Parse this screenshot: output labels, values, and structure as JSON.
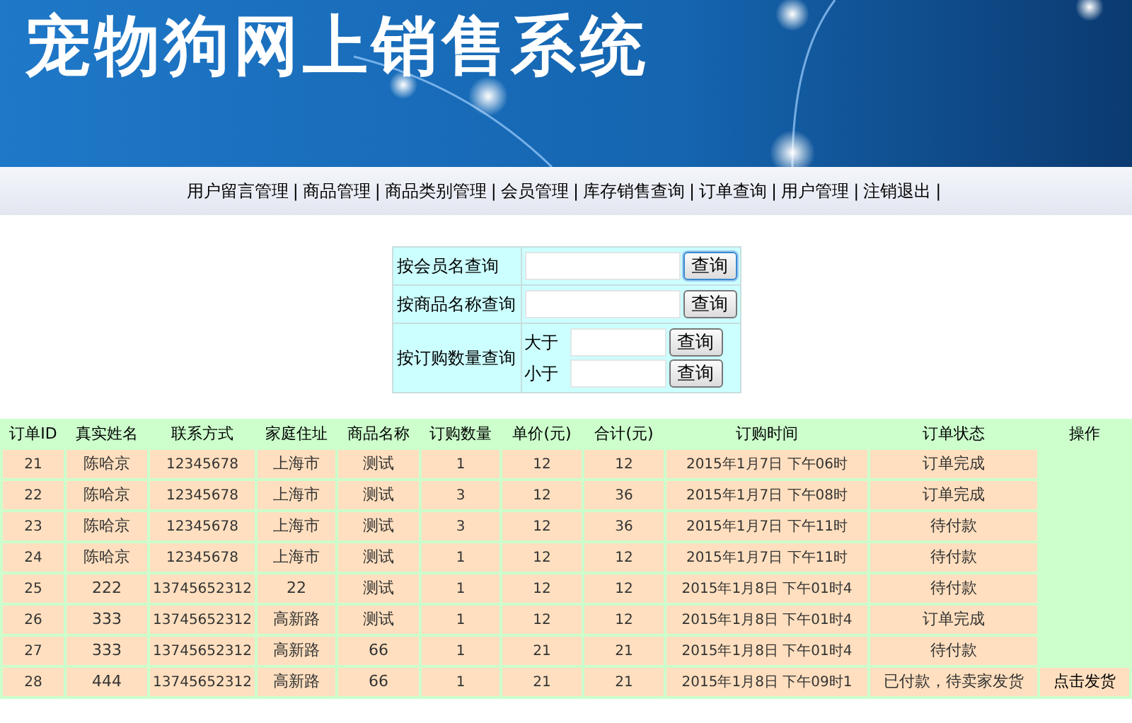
{
  "banner": {
    "title": "宠物狗网上销售系统"
  },
  "nav": {
    "items": [
      "用户留言管理",
      "商品管理",
      "商品类别管理",
      "会员管理",
      "库存销售查询",
      "订单查询",
      "用户管理",
      "注销退出"
    ],
    "separator": "|"
  },
  "search_form": {
    "rows": [
      {
        "kind": "single",
        "label": "按会员名查询",
        "fields": [
          {
            "button": "查询",
            "focused": true
          }
        ]
      },
      {
        "kind": "single",
        "label": "按商品名称查询",
        "fields": [
          {
            "button": "查询",
            "focused": false
          }
        ]
      },
      {
        "kind": "range",
        "label": "按订购数量查询",
        "fields": [
          {
            "prefix": "大于",
            "button": "查询",
            "focused": false
          },
          {
            "prefix": "小于",
            "button": "查询",
            "focused": false
          }
        ]
      }
    ]
  },
  "orders": {
    "columns": [
      "订单ID",
      "真实姓名",
      "联系方式",
      "家庭住址",
      "商品名称",
      "订购数量",
      "单价(元)",
      "合计(元)",
      "订购时间",
      "订单状态",
      "操作"
    ],
    "rows": [
      {
        "cells": [
          "21",
          "陈哈京",
          "12345678",
          "上海市",
          "测试",
          "1",
          "12",
          "12",
          "2015年1月7日 下午06时",
          "订单完成"
        ]
      },
      {
        "cells": [
          "22",
          "陈哈京",
          "12345678",
          "上海市",
          "测试",
          "3",
          "12",
          "36",
          "2015年1月7日 下午08时",
          "订单完成"
        ]
      },
      {
        "cells": [
          "23",
          "陈哈京",
          "12345678",
          "上海市",
          "测试",
          "3",
          "12",
          "36",
          "2015年1月7日 下午11时",
          "待付款"
        ]
      },
      {
        "cells": [
          "24",
          "陈哈京",
          "12345678",
          "上海市",
          "测试",
          "1",
          "12",
          "12",
          "2015年1月7日 下午11时",
          "待付款"
        ]
      },
      {
        "cells": [
          "25",
          "222",
          "13745652312",
          "22",
          "测试",
          "1",
          "12",
          "12",
          "2015年1月8日 下午01时4",
          "待付款"
        ]
      },
      {
        "cells": [
          "26",
          "333",
          "13745652312",
          "高新路",
          "测试",
          "1",
          "12",
          "12",
          "2015年1月8日 下午01时4",
          "订单完成"
        ]
      },
      {
        "cells": [
          "27",
          "333",
          "13745652312",
          "高新路",
          "66",
          "1",
          "21",
          "21",
          "2015年1月8日 下午01时4",
          "待付款"
        ]
      },
      {
        "cells": [
          "28",
          "444",
          "13745652312",
          "高新路",
          "66",
          "1",
          "21",
          "21",
          "2015年1月8日 下午09时1",
          "已付款，待卖家发货"
        ],
        "action": "点击发货"
      }
    ]
  }
}
